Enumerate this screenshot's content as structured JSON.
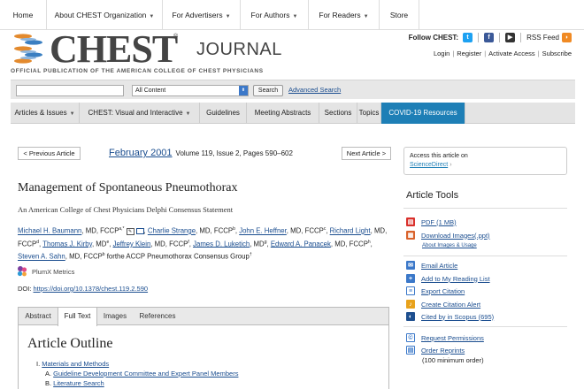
{
  "topnav": {
    "home": "Home",
    "about": "About CHEST Organization",
    "advertisers": "For Advertisers",
    "authors": "For Authors",
    "readers": "For Readers",
    "store": "Store"
  },
  "header": {
    "brand": "CHEST",
    "journal": "JOURNAL",
    "tagline": "OFFICIAL PUBLICATION OF THE AMERICAN COLLEGE OF CHEST PHYSICIANS",
    "follow_label": "Follow CHEST:",
    "rss": "RSS Feed",
    "account_links": [
      "Login",
      "Register",
      "Activate Access",
      "Subscribe"
    ]
  },
  "search": {
    "placeholder": "",
    "scope_selected": "All Content",
    "button": "Search",
    "advanced": "Advanced Search"
  },
  "sectionnav": {
    "articles": "Articles & Issues",
    "visual": "CHEST: Visual and Interactive",
    "guidelines": "Guidelines",
    "abstracts": "Meeting Abstracts",
    "sections": "Sections",
    "topics": "Topics",
    "covid": "COVID-19 Resources"
  },
  "article_nav": {
    "previous": "< Previous Article",
    "next": "Next Article >",
    "month": "February 2001",
    "issue": "Volume 119, Issue 2, Pages 590–602"
  },
  "article": {
    "title": "Management of Spontaneous Pneumothorax",
    "subtitle": "An American College of Chest Physicians Delphi Consensus Statement",
    "authors": [
      {
        "name": "Michael H. Baumann",
        "cred": ", MD, FCCP",
        "sup": "a,*"
      },
      {
        "name": "Charlie Strange",
        "cred": ", MD, FCCP",
        "sup": "b"
      },
      {
        "name": "John E. Heffner",
        "cred": ", MD, FCCP",
        "sup": "c"
      },
      {
        "name": "Richard Light",
        "cred": ", MD, FCCP",
        "sup": "d"
      },
      {
        "name": "Thomas J. Kirby",
        "cred": ", MD",
        "sup": "e"
      },
      {
        "name": "Jeffrey Klein",
        "cred": ", MD, FCCP",
        "sup": "f"
      },
      {
        "name": "James D. Luketich",
        "cred": ", MD",
        "sup": "g"
      },
      {
        "name": "Edward A. Panacek",
        "cred": ", MD, FCCP",
        "sup": "h"
      },
      {
        "name": "Steven A. Sahn",
        "cred": ", MD, FCCP",
        "sup": "b"
      }
    ],
    "authors_suffix": " forthe ACCP Pneumothorax Consensus Group",
    "authors_suffix_sup": "†",
    "plumx": "PlumX Metrics",
    "doi_label": "DOI: ",
    "doi_link": "https://doi.org/10.1378/chest.119.2.590"
  },
  "tabs": [
    "Abstract",
    "Full Text",
    "Images",
    "References"
  ],
  "outline": {
    "title": "Article Outline",
    "items": [
      {
        "label": "I. ",
        "link": "Materials and Methods"
      },
      {
        "label": "A. ",
        "link": "Guideline Development Committee and Expert Panel Members"
      },
      {
        "label": "B. ",
        "link": "Literature Search"
      }
    ]
  },
  "sidebar": {
    "access_text": "Access this article on",
    "access_link": "ScienceDirect",
    "tools_title": "Article Tools",
    "tools": {
      "pdf": "PDF (1 MB)",
      "download_images": "Download Images(.ppt)",
      "about_images": "About Images & Usage",
      "email": "Email Article",
      "reading_list": "Add to My Reading List",
      "export": "Export Citation",
      "alert": "Create Citation Alert",
      "scopus": "Cited by in Scopus (695)",
      "permissions": "Request Permissions",
      "reprints": "Order Reprints",
      "reprints_note": "(100 minimum order)"
    }
  },
  "colors": {
    "link": "#1a4d8f",
    "covid_tab": "#1e7fb6",
    "nav_bg": "#e4e4e4"
  }
}
